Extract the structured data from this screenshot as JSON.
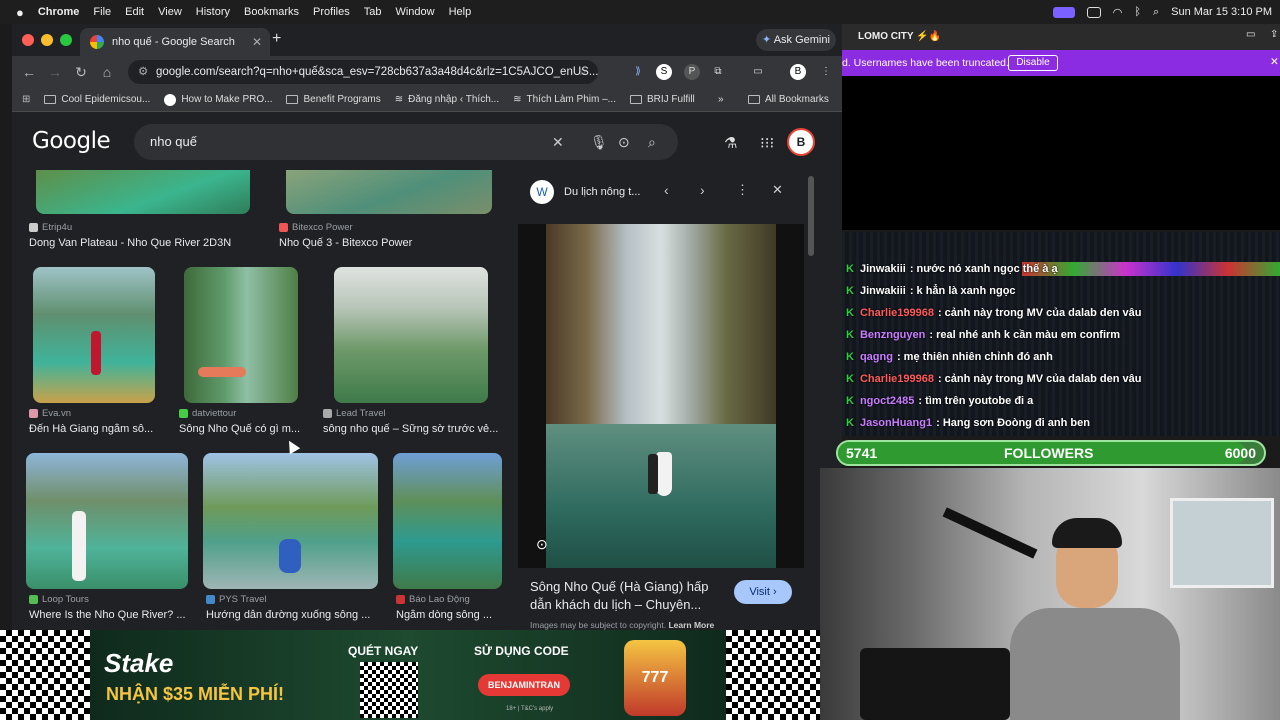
{
  "menubar": {
    "app": "Chrome",
    "items": [
      "File",
      "Edit",
      "View",
      "History",
      "Bookmarks",
      "Profiles",
      "Tab",
      "Window",
      "Help"
    ],
    "clock": "Sun Mar 15  3:10 PM"
  },
  "browser": {
    "tab_title": "nho quế - Google Search",
    "url": "google.com/search?q=nho+quế&sca_esv=728cb637a3a48d4c&rlz=1C5AJCO_enUS...",
    "ask_gemini": "Ask Gemini",
    "bookmarks": [
      "Cool Epidemicsou...",
      "How to Make PRO...",
      "Benefit Programs",
      "Đăng nhập ‹ Thích...",
      "Thích Làm Phim –...",
      "BRIJ Fulfill"
    ],
    "all_bookmarks": "All Bookmarks"
  },
  "google": {
    "logo": "Google",
    "query": "nho quế"
  },
  "results": [
    {
      "source": "Etrip4u",
      "caption": "Dong Van Plateau - Nho Que River 2D3N",
      "color": "#3f9a6f"
    },
    {
      "source": "Bitexco Power",
      "caption": "Nho Quế 3 - Bitexco Power",
      "color": "#6a8a5a"
    },
    {
      "source": "Eva.vn",
      "caption": "Đến Hà Giang ngắm sô...",
      "color": "#5ea88a"
    },
    {
      "source": "datviettour",
      "caption": "Sông Nho Quế có gì m...",
      "color": "#4d8f6a"
    },
    {
      "source": "Lead Travel",
      "caption": "sông nho quế – Sững sờ trước vẻ...",
      "color": "#7c9a7a"
    },
    {
      "source": "Loop Tours",
      "caption": "Where Is the Nho Que River? ...",
      "color": "#5aa08a"
    },
    {
      "source": "PYS Travel",
      "caption": "Hướng dẫn đường xuống sông ...",
      "color": "#5f9a55"
    },
    {
      "source": "Báo Lao Động",
      "caption": "Ngắm dòng sông ...",
      "color": "#2e8f8a"
    }
  ],
  "preview": {
    "site": "Du lịch nông t...",
    "title": "Sông Nho Quế (Hà Giang) hấp dẫn khách du lịch – Chuyên...",
    "visit": "Visit",
    "copyright": "Images may be subject to copyright.",
    "learn_more": "Learn More"
  },
  "stream": {
    "obs_title": "LOMO CITY ⚡🔥",
    "notice": "d. Usernames have been truncated.",
    "disable": "Disable",
    "chat": [
      {
        "user": "Jinwakiii",
        "msg": ": nước nó xanh ngọc thế à ạ"
      },
      {
        "user": "Jinwakiii",
        "msg": ": k hẳn là xanh ngọc"
      },
      {
        "user": "Charlie199968",
        "msg": ": cảnh này trong MV của dalab den vâu"
      },
      {
        "user": "Benznguyen",
        "msg": ": real nhé anh k cần màu em confirm"
      },
      {
        "user": "qagng",
        "msg": ": mẹ thiên nhiên chỉnh đó anh"
      },
      {
        "user": "Charlie199968",
        "msg": ": cảnh này trong MV của dalab den vâu"
      },
      {
        "user": "ngoct2485",
        "msg": ": tìm trên youtobe đi a"
      },
      {
        "user": "JasonHuang1",
        "msg": ": Hang sơn Đoòng đi anh ben"
      }
    ],
    "user_colors": [
      "#fff",
      "#fff",
      "#ff5b5b",
      "#c77dff",
      "#c77dff",
      "#ff5b5b",
      "#c77dff",
      "#c77dff"
    ],
    "followers_label": "FOLLOWERS",
    "followers_current": "5741",
    "followers_goal": "6000",
    "followers_progress": 0.957
  },
  "ad": {
    "brand": "Stake",
    "offer": "NHẬN $35 MIỄN PHÍ!",
    "scan": "QUÉT NGAY",
    "code_label": "SỬ DỤNG CODE",
    "code": "BENJAMINTRAN",
    "slot": "777",
    "fine_print": "18+ | T&C's apply"
  }
}
